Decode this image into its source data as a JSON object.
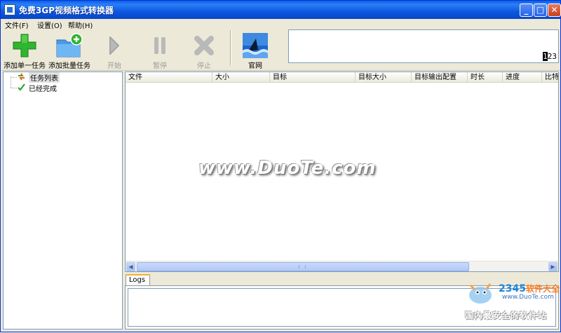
{
  "window": {
    "title": "免费3GP视频格式转换器",
    "min_glyph": "_",
    "max_glyph": "□",
    "close_glyph": "✕"
  },
  "menu": {
    "items": [
      {
        "label": "文件(F)"
      },
      {
        "label": "设置(O)"
      },
      {
        "label": "帮助(H)"
      }
    ]
  },
  "toolbar": {
    "add_single": "添加单一任务",
    "add_batch": "添加批量任务",
    "start": "开始",
    "pause": "暂停",
    "stop": "停止",
    "website": "官网",
    "display_digits_hl": "1",
    "display_digits_rest": "23"
  },
  "tree": {
    "items": [
      {
        "label": "任务列表"
      },
      {
        "label": "已经完成"
      }
    ]
  },
  "table": {
    "columns": [
      "文件",
      "大小",
      "目标",
      "目标大小",
      "目标输出配置",
      "时长",
      "进度",
      "比特"
    ]
  },
  "logs": {
    "tab_label": "Logs"
  },
  "watermarks": {
    "duote": "www.DuoTe.com",
    "brand_digits": "2345",
    "brand_text": "软件大全",
    "brand_url": "www.DuoTe.com",
    "slogan": "国内最安全的软件站"
  },
  "colors": {
    "titlebar": "#0b58df",
    "add_green": "#2fb52f",
    "folder_blue": "#4a9be8",
    "disabled_gray": "#b9b9b9"
  }
}
